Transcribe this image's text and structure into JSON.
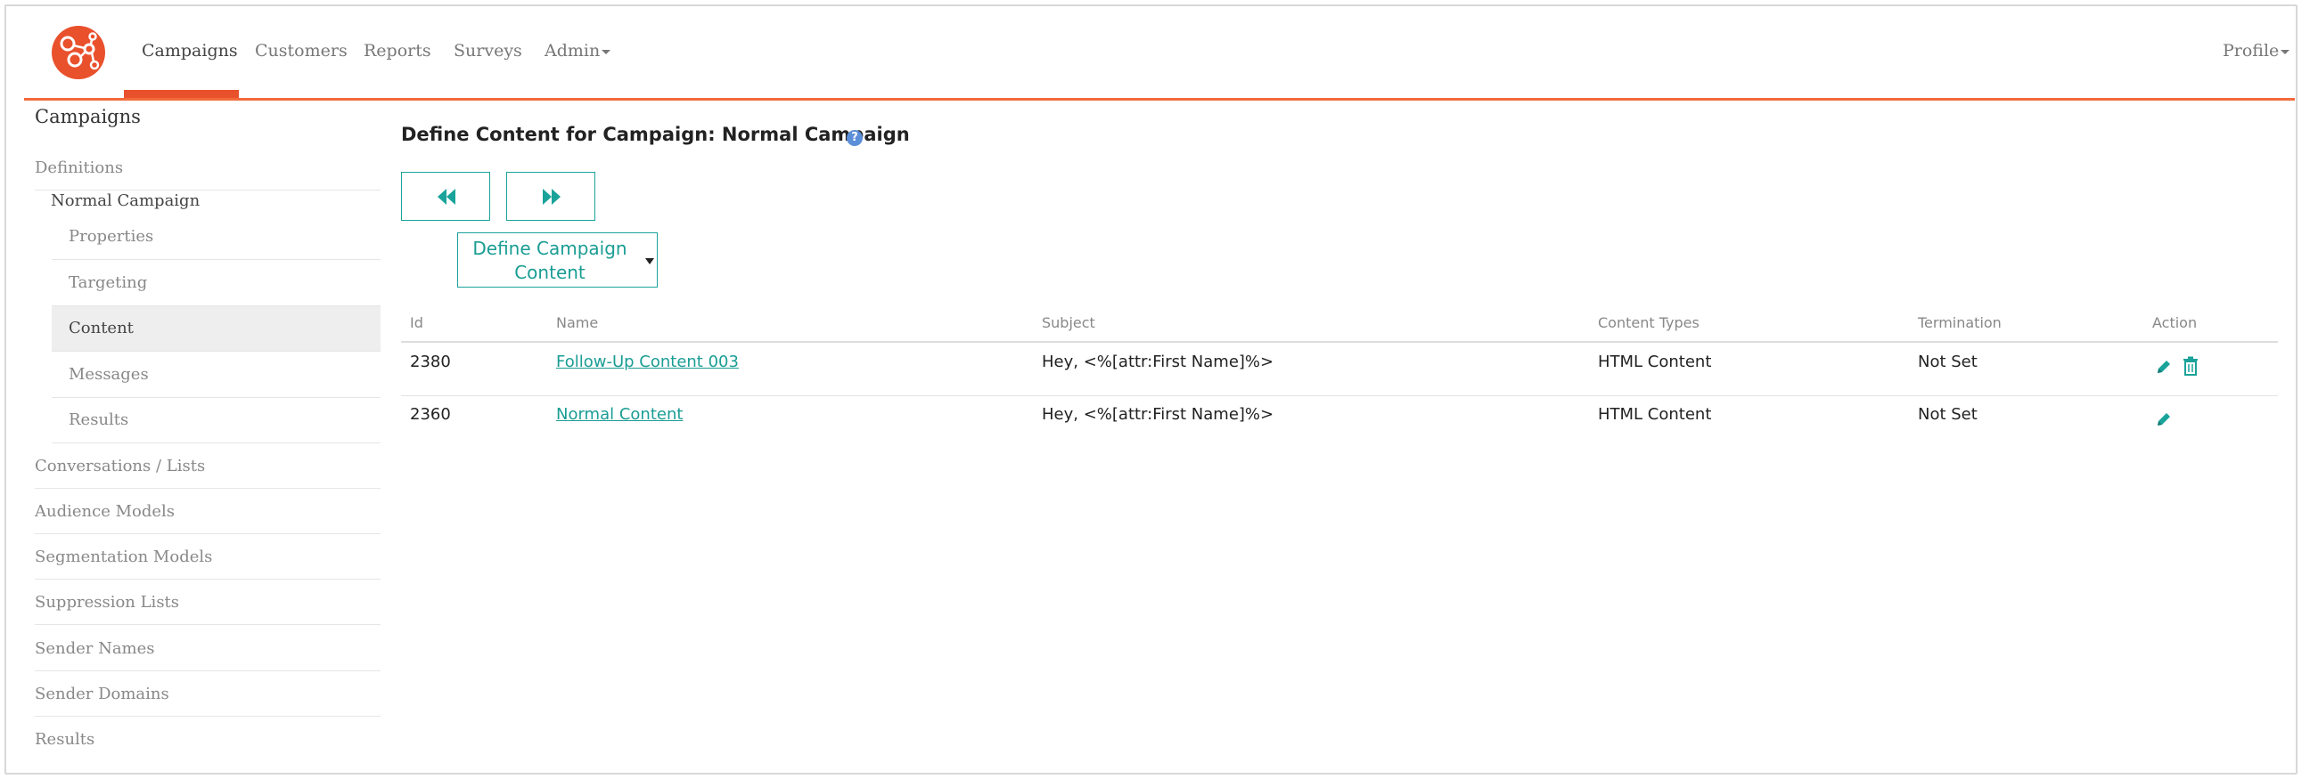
{
  "nav": {
    "items": [
      {
        "label": "Campaigns"
      },
      {
        "label": "Customers"
      },
      {
        "label": "Reports"
      },
      {
        "label": "Surveys"
      },
      {
        "label": "Admin"
      }
    ],
    "profile_label": "Profile",
    "accent_color": "#e9502c"
  },
  "sidebar": {
    "title": "Campaigns",
    "definitions_label": "Definitions",
    "campaign_name": "Normal Campaign",
    "sub_items": [
      {
        "label": "Properties"
      },
      {
        "label": "Targeting"
      },
      {
        "label": "Content"
      },
      {
        "label": "Messages"
      },
      {
        "label": "Results"
      }
    ],
    "items": [
      {
        "label": "Conversations / Lists"
      },
      {
        "label": "Audience Models"
      },
      {
        "label": "Segmentation Models"
      },
      {
        "label": "Suppression Lists"
      },
      {
        "label": "Sender Names"
      },
      {
        "label": "Sender Domains"
      },
      {
        "label": "Results"
      }
    ]
  },
  "main": {
    "title": "Define Content for Campaign: Normal Campaign",
    "info_icon": "?",
    "dropdown_label": "Define Campaign Content",
    "table": {
      "headers": {
        "id": "Id",
        "name": "Name",
        "subject": "Subject",
        "content_types": "Content Types",
        "termination": "Termination",
        "action": "Action"
      },
      "rows": [
        {
          "id": "2380",
          "name": "Follow-Up Content 003",
          "subject": "Hey, <%[attr:First Name]%>",
          "content_types": "HTML Content",
          "termination": "Not Set"
        },
        {
          "id": "2360",
          "name": "Normal Content",
          "subject": "Hey, <%[attr:First Name]%>",
          "content_types": "HTML Content",
          "termination": "Not Set"
        }
      ]
    },
    "teal_color": "#1aa39a"
  }
}
